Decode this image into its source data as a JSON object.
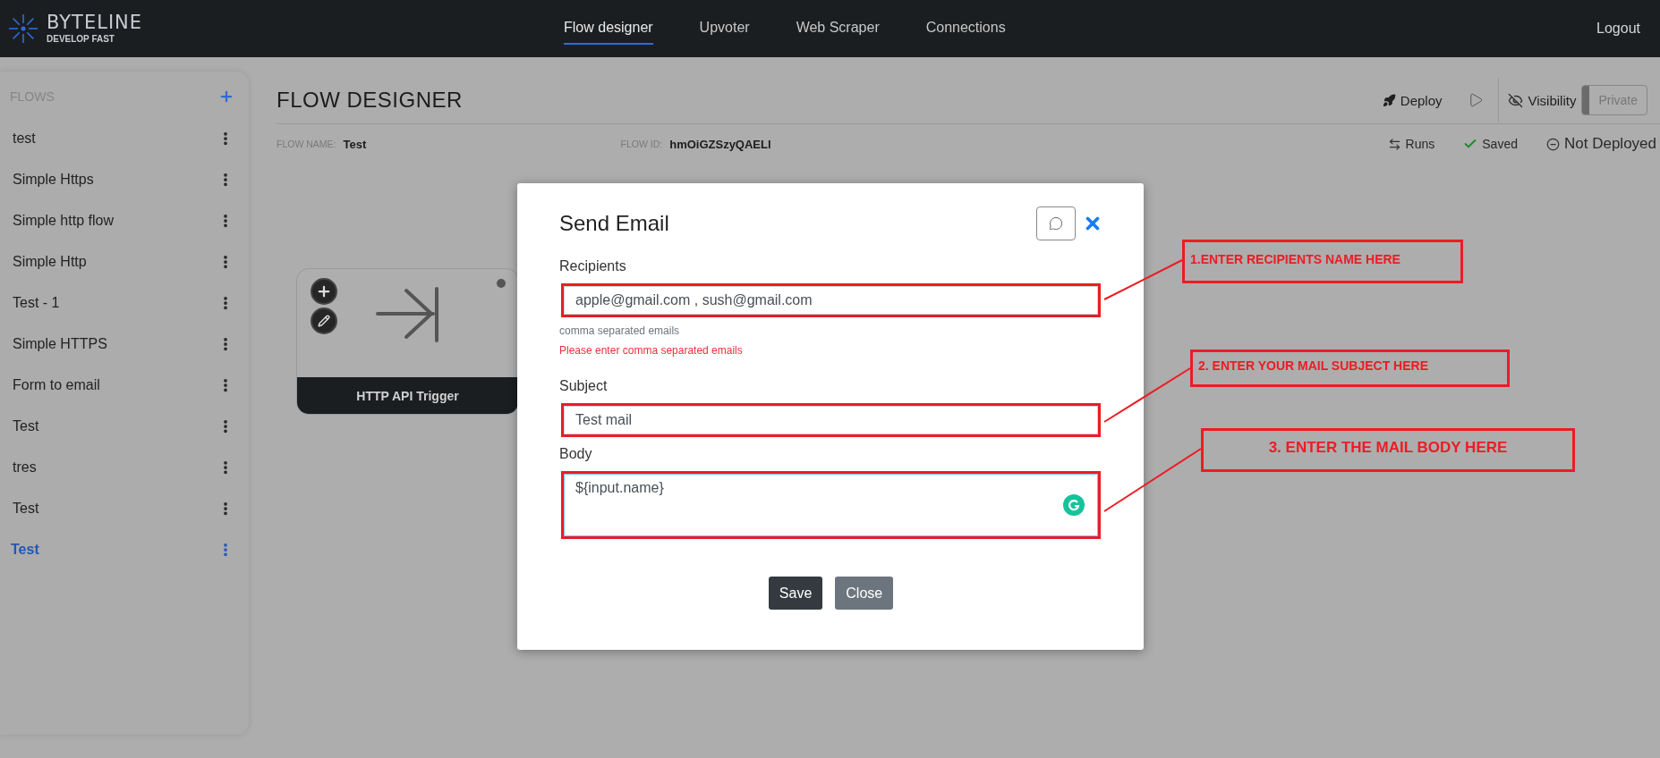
{
  "header": {
    "logo": {
      "name": "BYTELINE",
      "tagline": "DEVELOP FAST"
    },
    "nav": [
      {
        "label": "Flow designer",
        "selected": true
      },
      {
        "label": "Upvoter",
        "selected": false
      },
      {
        "label": "Web Scraper",
        "selected": false
      },
      {
        "label": "Connections",
        "selected": false
      }
    ],
    "logout": "Logout"
  },
  "sidebar": {
    "title": "FLOWS",
    "items": [
      {
        "label": "test",
        "selected": false
      },
      {
        "label": "Simple Https",
        "selected": false
      },
      {
        "label": "Simple http flow",
        "selected": false
      },
      {
        "label": "Simple Http",
        "selected": false
      },
      {
        "label": "Test - 1",
        "selected": false
      },
      {
        "label": "Simple HTTPS",
        "selected": false
      },
      {
        "label": "Form to email",
        "selected": false
      },
      {
        "label": "Test",
        "selected": false
      },
      {
        "label": "tres",
        "selected": false
      },
      {
        "label": "Test",
        "selected": false
      },
      {
        "label": "Test",
        "selected": true
      }
    ]
  },
  "page": {
    "title": "FLOW DESIGNER",
    "deploy": "Deploy",
    "visibility": "Visibility",
    "visibility_toggle": {
      "label": "Private",
      "on": false
    },
    "flow_name_label": "FLOW NAME:",
    "flow_name": "Test",
    "flow_id_label": "FLOW ID:",
    "flow_id": "hmOiGZSzyQAELl",
    "statuses": [
      {
        "kind": "runs",
        "label": "Runs"
      },
      {
        "kind": "saved",
        "label": "Saved"
      },
      {
        "kind": "not_deployed",
        "label": "Not Deployed"
      }
    ]
  },
  "canvas": {
    "nodes": [
      {
        "title": "HTTP API Trigger"
      }
    ]
  },
  "dialog": {
    "title": "Send Email",
    "fields": [
      {
        "kind": "input",
        "label": "Recipients",
        "value": "apple@gmail.com , sush@gmail.com",
        "help": "comma separated emails",
        "error": "Please enter comma separated emails"
      },
      {
        "kind": "input",
        "label": "Subject",
        "value": "Test mail"
      },
      {
        "kind": "textarea",
        "label": "Body",
        "value": "${input.name}"
      }
    ],
    "buttons": [
      {
        "kind": "primary",
        "label": "Save"
      },
      {
        "kind": "secondary",
        "label": "Close"
      }
    ]
  },
  "annotations": [
    {
      "text": "1.ENTER RECIPIENTS NAME HERE"
    },
    {
      "text": "2. ENTER YOUR MAIL SUBJECT HERE"
    },
    {
      "text": "3. ENTER THE MAIL BODY HERE"
    }
  ]
}
